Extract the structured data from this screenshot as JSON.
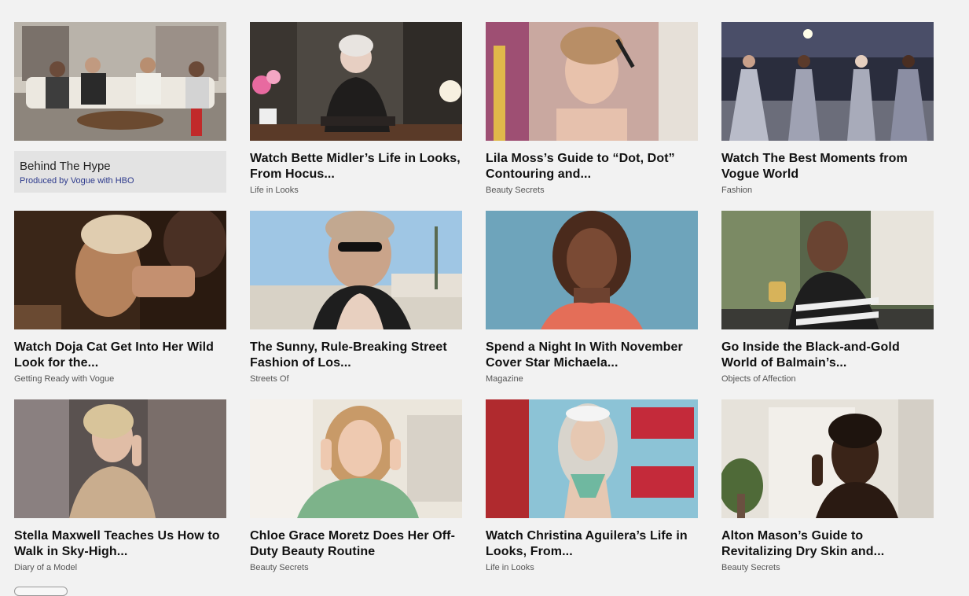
{
  "sponsor": {
    "title": "Behind The Hype",
    "subtitle": "Produced by Vogue with HBO"
  },
  "cards": [
    {
      "title": "",
      "tag": "",
      "thumb": "panel-discussion-image",
      "palette": [
        "#c9c3b8",
        "#ebe7df",
        "#3b3530"
      ]
    },
    {
      "title": "Watch Bette Midler’s Life in Looks, From Hocus...",
      "tag": "Life in Looks",
      "thumb": "bette-midler-image",
      "palette": [
        "#4a4640",
        "#2b2622",
        "#d9cfc4"
      ]
    },
    {
      "title": "Lila Moss’s Guide to “Dot, Dot” Contouring and...",
      "tag": "Beauty Secrets",
      "thumb": "lila-moss-image",
      "palette": [
        "#c7a28e",
        "#e8c6b2",
        "#a8506a"
      ]
    },
    {
      "title": "Watch The Best Moments from Vogue World",
      "tag": "Fashion",
      "thumb": "vogue-world-runway-image",
      "palette": [
        "#3a3e55",
        "#8f93a8",
        "#b9bcc9"
      ]
    },
    {
      "title": "Watch Doja Cat Get Into Her Wild Look for the...",
      "tag": "Getting Ready with Vogue",
      "thumb": "doja-cat-image",
      "palette": [
        "#5a3a22",
        "#b98762",
        "#2a1c12"
      ]
    },
    {
      "title": "The Sunny, Rule-Breaking Street Fashion of Los...",
      "tag": "Streets Of",
      "thumb": "street-fashion-image",
      "palette": [
        "#8ab6d8",
        "#c9dff0",
        "#2a2a2a"
      ]
    },
    {
      "title": "Spend a Night In With November Cover Star Michaela...",
      "tag": "Magazine",
      "thumb": "michaela-coel-image",
      "palette": [
        "#6fa3ba",
        "#4b2e22",
        "#e0735c"
      ]
    },
    {
      "title": "Go Inside the Black-and-Gold World of Balmain’s...",
      "tag": "Objects of Affection",
      "thumb": "balmain-image",
      "palette": [
        "#6d7a5a",
        "#2a2c2c",
        "#e7e2da"
      ]
    },
    {
      "title": "Stella Maxwell Teaches Us How to Walk in Sky-High...",
      "tag": "Diary of a Model",
      "thumb": "stella-maxwell-image",
      "palette": [
        "#5c5452",
        "#c8b49a",
        "#8d7a6c"
      ]
    },
    {
      "title": "Chloe Grace Moretz Does Her Off-Duty Beauty Routine",
      "tag": "Beauty Secrets",
      "thumb": "chloe-moretz-image",
      "palette": [
        "#e4ded3",
        "#7fb58c",
        "#c9a47a"
      ]
    },
    {
      "title": "Watch Christina Aguilera’s Life in Looks, From...",
      "tag": "Life in Looks",
      "thumb": "christina-aguilera-image",
      "palette": [
        "#b22a2e",
        "#8fc4d6",
        "#d8d0c6"
      ]
    },
    {
      "title": "Alton Mason’s Guide to Revitalizing Dry Skin and...",
      "tag": "Beauty Secrets",
      "thumb": "alton-mason-image",
      "palette": [
        "#e8e4dd",
        "#3a2a22",
        "#c7c2b8"
      ]
    }
  ]
}
